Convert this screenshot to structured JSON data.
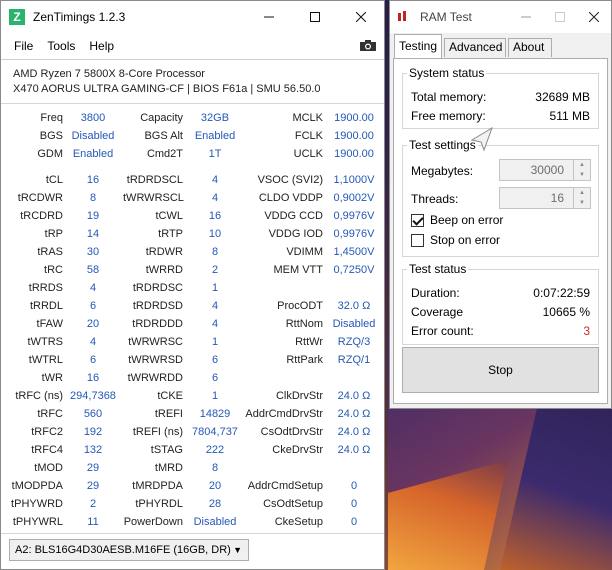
{
  "zentimings": {
    "title": "ZenTimings 1.2.3",
    "menu": [
      "File",
      "Tools",
      "Help"
    ],
    "cpu": "AMD Ryzen 7 5800X 8-Core Processor",
    "board": "X470 AORUS ULTRA GAMING-CF | BIOS F61a | SMU 56.50.0",
    "header_rows": [
      [
        "Freq",
        "3800",
        "Capacity",
        "32GB",
        "MCLK",
        "1900.00"
      ],
      [
        "BGS",
        "Disabled",
        "BGS Alt",
        "Enabled",
        "FCLK",
        "1900.00"
      ],
      [
        "GDM",
        "Enabled",
        "Cmd2T",
        "1T",
        "UCLK",
        "1900.00"
      ]
    ],
    "timing_rows": [
      [
        "tCL",
        "16",
        "tRDRDSCL",
        "4",
        "VSOC (SVI2)",
        "1,1000V"
      ],
      [
        "tRCDWR",
        "8",
        "tWRWRSCL",
        "4",
        "CLDO VDDP",
        "0,9002V"
      ],
      [
        "tRCDRD",
        "19",
        "tCWL",
        "16",
        "VDDG CCD",
        "0,9976V"
      ],
      [
        "tRP",
        "14",
        "tRTP",
        "10",
        "VDDG IOD",
        "0,9976V"
      ],
      [
        "tRAS",
        "30",
        "tRDWR",
        "8",
        "VDIMM",
        "1,4500V"
      ],
      [
        "tRC",
        "58",
        "tWRRD",
        "2",
        "MEM VTT",
        "0,7250V"
      ],
      [
        "tRRDS",
        "4",
        "tRDRDSC",
        "1",
        "",
        ""
      ],
      [
        "tRRDL",
        "6",
        "tRDRDSD",
        "4",
        "ProcODT",
        "32.0 Ω"
      ],
      [
        "tFAW",
        "20",
        "tRDRDDD",
        "4",
        "RttNom",
        "Disabled"
      ],
      [
        "tWTRS",
        "4",
        "tWRWRSC",
        "1",
        "RttWr",
        "RZQ/3"
      ],
      [
        "tWTRL",
        "6",
        "tWRWRSD",
        "6",
        "RttPark",
        "RZQ/1"
      ],
      [
        "tWR",
        "16",
        "tWRWRDD",
        "6",
        "",
        ""
      ],
      [
        "tRFC (ns)",
        "294,7368",
        "tCKE",
        "1",
        "ClkDrvStr",
        "24.0 Ω"
      ],
      [
        "tRFC",
        "560",
        "tREFI",
        "14829",
        "AddrCmdDrvStr",
        "24.0 Ω"
      ],
      [
        "tRFC2",
        "192",
        "tREFI (ns)",
        "7804,737",
        "CsOdtDrvStr",
        "24.0 Ω"
      ],
      [
        "tRFC4",
        "132",
        "tSTAG",
        "222",
        "CkeDrvStr",
        "24.0 Ω"
      ],
      [
        "tMOD",
        "29",
        "tMRD",
        "8",
        "",
        ""
      ],
      [
        "tMODPDA",
        "29",
        "tMRDPDA",
        "20",
        "AddrCmdSetup",
        "0"
      ],
      [
        "tPHYWRD",
        "2",
        "tPHYRDL",
        "28",
        "CsOdtSetup",
        "0"
      ],
      [
        "tPHYWRL",
        "11",
        "PowerDown",
        "Disabled",
        "CkeSetup",
        "0"
      ]
    ],
    "dimm_selected": "A2: BLS16G4D30AESB.M16FE (16GB, DR)"
  },
  "ramtest": {
    "title": "RAM Test",
    "tabs": [
      "Testing",
      "Advanced",
      "About"
    ],
    "system_status": {
      "title": "System status",
      "total_label": "Total memory:",
      "total_value": "32689 MB",
      "free_label": "Free memory:",
      "free_value": "511 MB"
    },
    "test_settings": {
      "title": "Test settings",
      "megabytes_label": "Megabytes:",
      "megabytes_value": "30000",
      "threads_label": "Threads:",
      "threads_value": "16",
      "beep_label": "Beep on error",
      "beep_checked": true,
      "stop_label": "Stop on error",
      "stop_checked": false
    },
    "test_status": {
      "title": "Test status",
      "duration_label": "Duration:",
      "duration_value": "0:07:22:59",
      "coverage_label": "Coverage",
      "coverage_value": "10665 %",
      "errors_label": "Error count:",
      "errors_value": "3"
    },
    "stop_button": "Stop"
  },
  "colors": {
    "value_blue": "#2458b8",
    "error_red": "#d42b2b",
    "logo_green": "#29b36b"
  }
}
